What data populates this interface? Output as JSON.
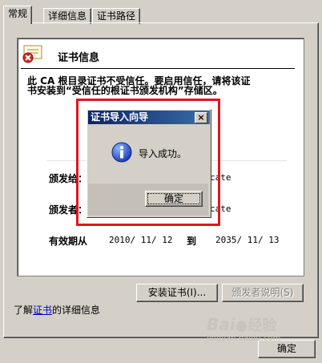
{
  "tabs": [
    {
      "label": "常规"
    },
    {
      "label": "详细信息"
    },
    {
      "label": "证书路径"
    }
  ],
  "cert": {
    "header": "证书信息",
    "warning_line1": "此 CA 根目录证书不受信任。要启用信任，请将该证",
    "warning_line2": "书安装到“受信任的根证书颁发机构”存储区。",
    "issued_to_label": "颁发给：",
    "issued_to_value": "cate",
    "issued_by_label": "颁发者：",
    "issued_by_value": "cate",
    "valid_label": "有效期从",
    "valid_from": "2010/ 11/ 12",
    "valid_to_label": "到",
    "valid_to": "2035/ 11/ 13"
  },
  "buttons": {
    "install": "安装证书(I)...",
    "issuer_statement": "颁发者说明(S)",
    "ok": "确定"
  },
  "learn_more": {
    "prefix": "了解",
    "link": "证书",
    "suffix": "的详细信息"
  },
  "dialog": {
    "title": "证书导入向导",
    "message": "导入成功。",
    "ok": "确定",
    "close": "×"
  },
  "watermark": {
    "brand": "Bai",
    "brand2": "经验",
    "url": "jingyan.baidu.com"
  },
  "colors": {
    "highlight_frame": "#e0161d",
    "title_active": "#0a246a"
  }
}
